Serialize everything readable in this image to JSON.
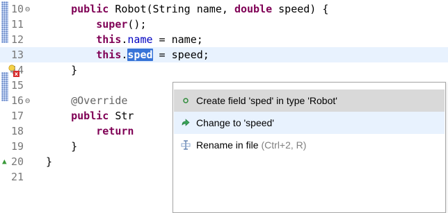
{
  "editor": {
    "lines": [
      {
        "num": "10",
        "fold": "⊖",
        "tokens": [
          [
            "pad",
            "    "
          ],
          [
            "kw",
            "public"
          ],
          [
            "t",
            " Robot(String "
          ],
          [
            "t",
            "name, "
          ],
          [
            "kw",
            "double"
          ],
          [
            "t",
            " speed) {"
          ]
        ]
      },
      {
        "num": "11",
        "fold": "",
        "tokens": [
          [
            "pad",
            "        "
          ],
          [
            "kw",
            "super"
          ],
          [
            "t",
            "();"
          ]
        ]
      },
      {
        "num": "12",
        "fold": "",
        "tokens": [
          [
            "pad",
            "        "
          ],
          [
            "kw",
            "this"
          ],
          [
            "t",
            "."
          ],
          [
            "fld",
            "name"
          ],
          [
            "t",
            " = name;"
          ]
        ]
      },
      {
        "num": "13",
        "fold": "",
        "tokens": [
          [
            "pad",
            "        "
          ],
          [
            "kw",
            "this"
          ],
          [
            "t",
            "."
          ],
          [
            "sel",
            "sped"
          ],
          [
            "t",
            " = speed;"
          ]
        ]
      },
      {
        "num": "14",
        "fold": "",
        "tokens": [
          [
            "pad",
            "    "
          ],
          [
            "t",
            "}"
          ]
        ]
      },
      {
        "num": "15",
        "fold": "",
        "tokens": []
      },
      {
        "num": "16",
        "fold": "⊖",
        "tokens": [
          [
            "pad",
            "    "
          ],
          [
            "ann",
            "@Override"
          ]
        ]
      },
      {
        "num": "17",
        "fold": "",
        "tokens": [
          [
            "pad",
            "    "
          ],
          [
            "kw",
            "public"
          ],
          [
            "t",
            " Str"
          ]
        ]
      },
      {
        "num": "18",
        "fold": "",
        "tokens": [
          [
            "pad",
            "        "
          ],
          [
            "kw",
            "return"
          ]
        ]
      },
      {
        "num": "19",
        "fold": "",
        "tokens": [
          [
            "pad",
            "    "
          ],
          [
            "t",
            "}"
          ]
        ]
      },
      {
        "num": "20",
        "fold": "",
        "tokens": [
          [
            "t",
            "}"
          ]
        ]
      },
      {
        "num": "21",
        "fold": "",
        "tokens": []
      }
    ]
  },
  "quickfix": {
    "proposals": [
      {
        "icon": "field-dot-icon",
        "label": "Create field 'sped' in type 'Robot'",
        "hint": ""
      },
      {
        "icon": "change-arrow-icon",
        "label": "Change to 'speed'",
        "hint": ""
      },
      {
        "icon": "rename-icon",
        "label": "Rename in file",
        "hint": "(Ctrl+2, R)"
      }
    ]
  },
  "colors": {
    "keyword": "#7f0055",
    "field": "#0000c0",
    "selection": "#3874d8",
    "current_line": "#e8f2fe"
  }
}
